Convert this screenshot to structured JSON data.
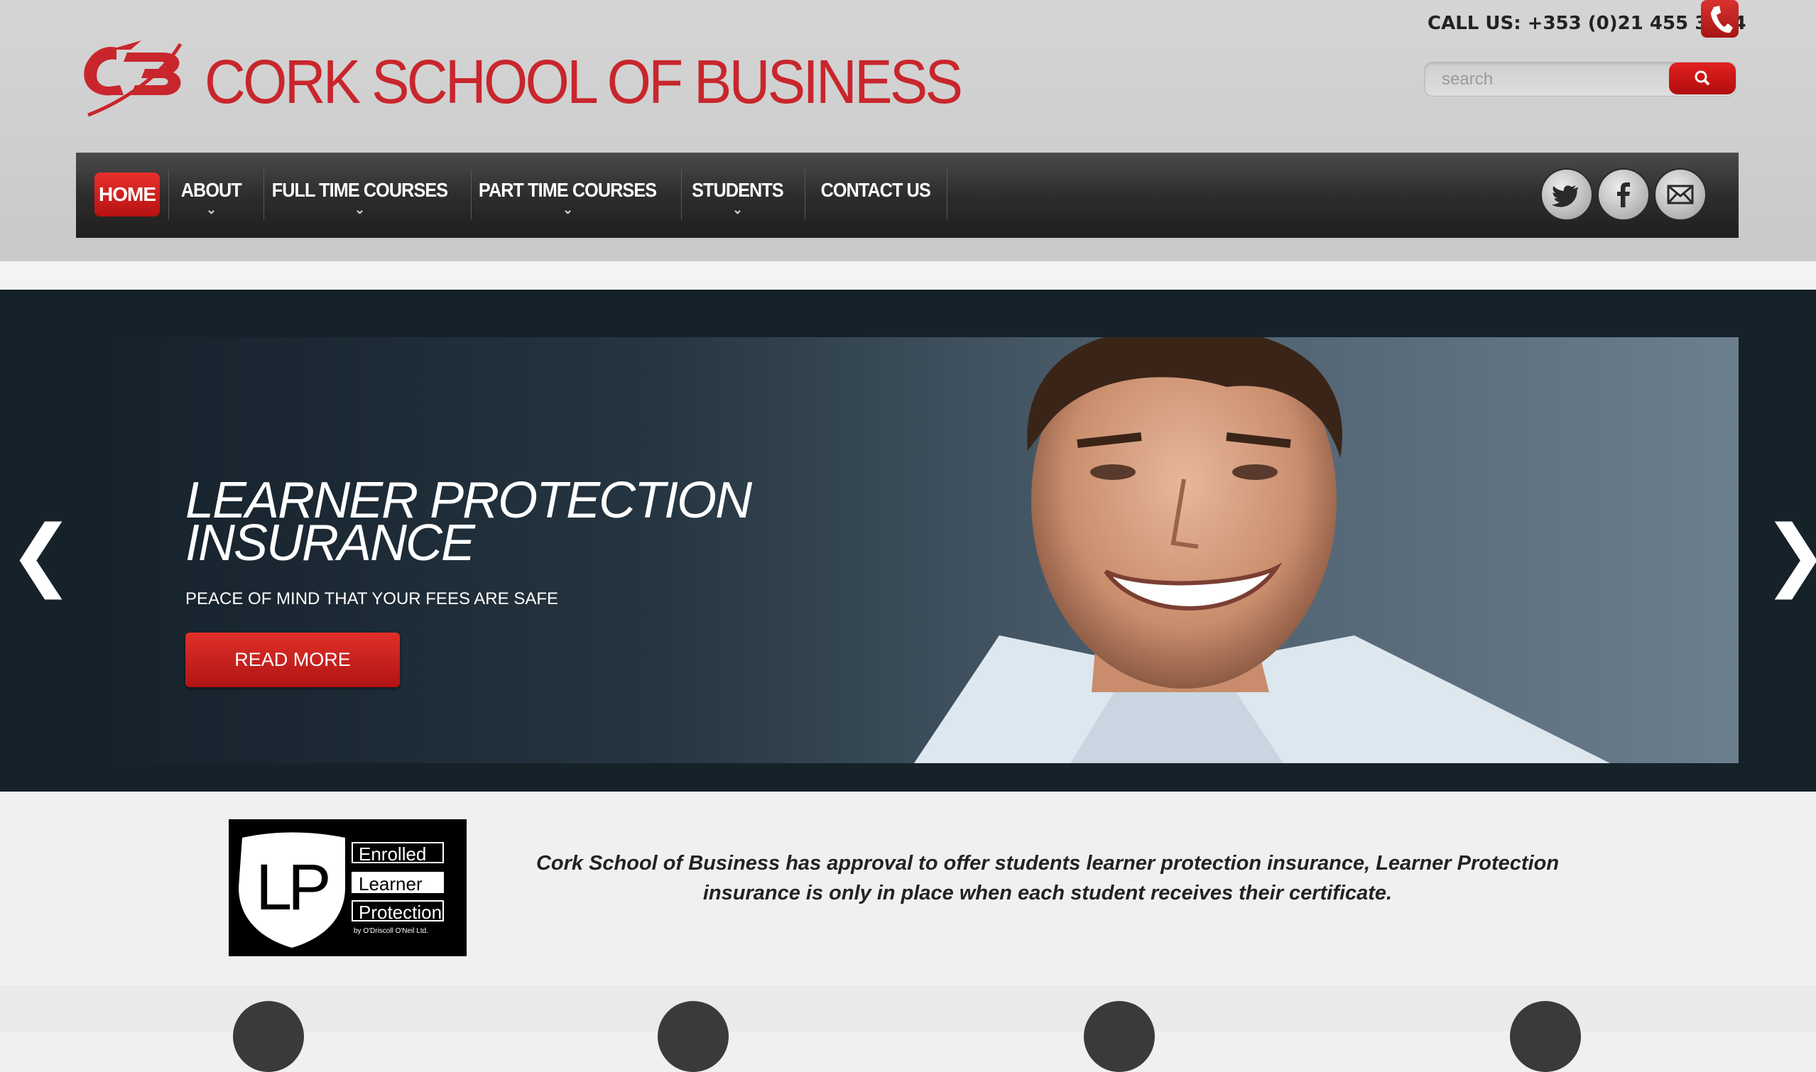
{
  "header": {
    "logo_text": "CORK SCHOOL OF BUSINESS",
    "call_us": "CALL US: +353 (0)21 455 3864",
    "search_placeholder": "search"
  },
  "nav": {
    "items": [
      {
        "label": "HOME",
        "active": true,
        "dropdown": false
      },
      {
        "label": "ABOUT",
        "dropdown": true
      },
      {
        "label": "FULL TIME COURSES",
        "dropdown": true
      },
      {
        "label": "PART TIME COURSES",
        "dropdown": true
      },
      {
        "label": "STUDENTS",
        "dropdown": true
      },
      {
        "label": "CONTACT US",
        "dropdown": false
      }
    ],
    "social": [
      "twitter-icon",
      "facebook-icon",
      "email-icon"
    ]
  },
  "hero": {
    "title": "LEARNER PROTECTION\nINSURANCE",
    "subtitle": "PEACE OF MIND THAT YOUR FEES ARE SAFE",
    "button": "READ MORE",
    "prev": "❮",
    "next": "❯"
  },
  "badge": {
    "initials": "LP",
    "lines": [
      "Enrolled",
      "Learner",
      "Protection"
    ],
    "byline": "by O'Driscoll O'Neil Ltd."
  },
  "description": "Cork School of Business has approval to offer students learner protection insurance, Learner Protection insurance is only in place when each student receives their certificate.",
  "colors": {
    "brand_red": "#c8262c",
    "nav_dark": "#2d2d2d"
  }
}
